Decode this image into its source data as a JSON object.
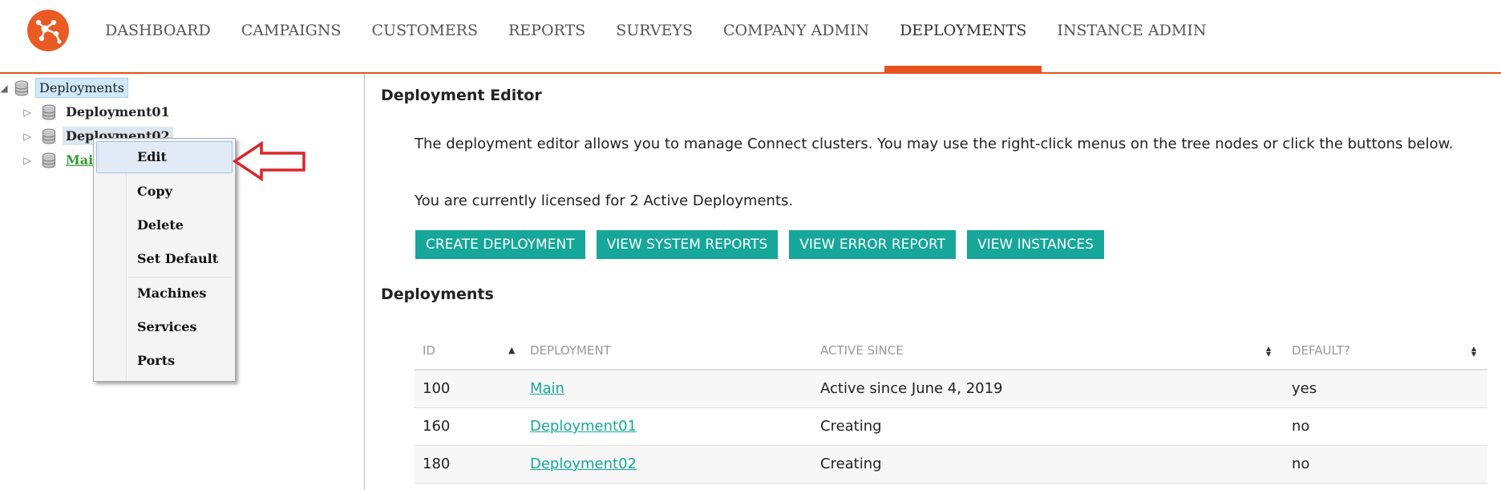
{
  "nav": {
    "items": [
      {
        "label": "DASHBOARD"
      },
      {
        "label": "CAMPAIGNS"
      },
      {
        "label": "CUSTOMERS"
      },
      {
        "label": "REPORTS"
      },
      {
        "label": "SURVEYS"
      },
      {
        "label": "COMPANY ADMIN"
      },
      {
        "label": "DEPLOYMENTS",
        "active": true
      },
      {
        "label": "INSTANCE ADMIN"
      }
    ]
  },
  "tree": {
    "root": "Deployments",
    "children": [
      "Deployment01",
      "Deployment02",
      "Main"
    ]
  },
  "context_menu": {
    "items": [
      "Edit",
      "Copy",
      "Delete",
      "Set Default",
      "Machines",
      "Services",
      "Ports"
    ]
  },
  "editor": {
    "title": "Deployment Editor",
    "description": "The deployment editor allows you to manage Connect clusters. You may use the right-click menus on the tree nodes or click the buttons below.",
    "license": "You are currently licensed for 2 Active Deployments.",
    "buttons": [
      "CREATE DEPLOYMENT",
      "VIEW SYSTEM REPORTS",
      "VIEW ERROR REPORT",
      "VIEW INSTANCES"
    ]
  },
  "deployments": {
    "title": "Deployments",
    "columns": [
      "ID",
      "DEPLOYMENT",
      "ACTIVE SINCE",
      "DEFAULT?"
    ],
    "rows": [
      {
        "id": "100",
        "name": "Main",
        "active_since": "Active since June 4, 2019",
        "default": "yes"
      },
      {
        "id": "160",
        "name": "Deployment01",
        "active_since": "Creating",
        "default": "no"
      },
      {
        "id": "180",
        "name": "Deployment02",
        "active_since": "Creating",
        "default": "no"
      }
    ]
  },
  "colors": {
    "accent": "#e8531d",
    "button": "#16a79a",
    "link": "#16a79a",
    "tree_main": "#2e9a2e",
    "arrow": "#d9262c"
  }
}
